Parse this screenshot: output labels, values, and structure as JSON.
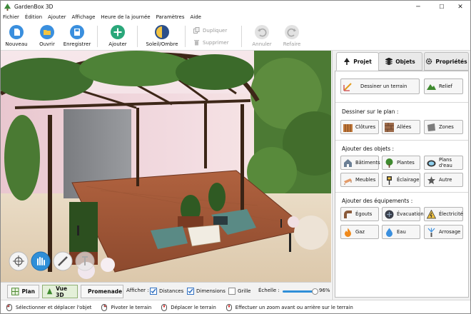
{
  "app": {
    "title": "GardenBox 3D"
  },
  "window_controls": {
    "minimize": "─",
    "maximize": "☐",
    "close": "✕"
  },
  "menu": [
    "Fichier",
    "Édition",
    "Ajouter",
    "Affichage",
    "Heure de la journée",
    "Paramètres",
    "Aide"
  ],
  "toolbar": {
    "new": "Nouveau",
    "open": "Ouvrir",
    "save": "Enregistrer",
    "add": "Ajouter",
    "sun": "Soleil/Ombre",
    "duplicate": "Dupliquer",
    "delete": "Supprimer",
    "undo": "Annuler",
    "redo": "Refaire"
  },
  "viewbar": {
    "plan": "Plan",
    "view3d": "Vue 3D",
    "walk": "Promenade",
    "show_label": "Afficher :",
    "distances": "Distances",
    "distances_checked": true,
    "dimensions": "Dimensions",
    "dimensions_checked": true,
    "grid": "Grille",
    "grid_checked": false,
    "scale_label": "Échelle :",
    "scale_value": "96%",
    "scale_fraction": 0.96
  },
  "status": [
    "Sélectionner et déplacer l'objet",
    "Pivoter le terrain",
    "Déplacer le terrain",
    "Effectuer un zoom avant ou arrière sur le terrain"
  ],
  "panel": {
    "tabs": [
      "Projet",
      "Objets",
      "Propriétés"
    ],
    "active_tab": "Projet",
    "draw_terrain": "Dessiner un terrain",
    "relief": "Relief",
    "draw_on_plan": "Dessiner sur le plan :",
    "fences": "Clôtures",
    "paths": "Allées",
    "zones": "Zones",
    "add_objects": "Ajouter des objets :",
    "buildings": "Bâtiments",
    "plants": "Plantes",
    "water": "Plans d'eau",
    "furniture": "Meubles",
    "lighting": "Éclairage",
    "other": "Autre",
    "add_equipment": "Ajouter des équipements :",
    "sewer": "Égouts",
    "drainage": "Évacuation",
    "electricity": "Électricité",
    "gas": "Gaz",
    "water_supply": "Eau",
    "watering": "Arrosage"
  },
  "colors": {
    "accent": "#2f8fd8",
    "add_green": "#2aa77a",
    "active_tab_bg": "#ffffff",
    "panel_bg": "#f0f0f0"
  }
}
